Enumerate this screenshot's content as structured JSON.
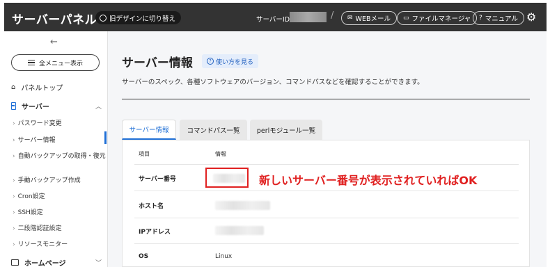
{
  "header": {
    "brand": "サーバーパネル",
    "old_design_label": "旧デザインに切り替え",
    "server_id_label": "サーバーID",
    "slash": "/",
    "webmail_label": "WEBメール",
    "filemanager_label": "ファイルマネージャ",
    "manual_label": "マニュアル"
  },
  "sidebar": {
    "back": "←",
    "menu_button": "全メニュー表示",
    "panel_top": "パネルトップ",
    "server_section": "サーバー",
    "server_items": [
      "パスワード変更",
      "サーバー情報",
      "自動バックアップの取得・復元",
      "手動バックアップ作成",
      "Cron設定",
      "SSH設定",
      "二段階認証設定",
      "リソースモニター"
    ],
    "home_section": "ホームページ"
  },
  "main": {
    "title": "サーバー情報",
    "howto": "使い方を見る",
    "description": "サーバーのスペック、各種ソフトウェアのバージョン、コマンドパスなどを確認することができます。",
    "tabs": [
      "サーバー情報",
      "コマンドパス一覧",
      "perlモジュール一覧"
    ],
    "table": {
      "col_item": "項目",
      "col_info": "情報",
      "rows": [
        {
          "label": "サーバー番号",
          "value": ""
        },
        {
          "label": "ホスト名",
          "value": ""
        },
        {
          "label": "IPアドレス",
          "value": ""
        },
        {
          "label": "OS",
          "value": "Linux"
        }
      ]
    },
    "annotation": "新しいサーバー番号が表示されていればOK"
  },
  "colors": {
    "header_bg": "#333333",
    "accent": "#1f6fd6",
    "annotation": "#e02020"
  },
  "icons": [
    "sync-icon",
    "webmail-icon",
    "folder-icon",
    "help-icon",
    "gear-icon",
    "home-icon",
    "server-icon",
    "chevron-up-icon",
    "chevron-down-icon",
    "back-arrow-icon",
    "menu-icon"
  ]
}
